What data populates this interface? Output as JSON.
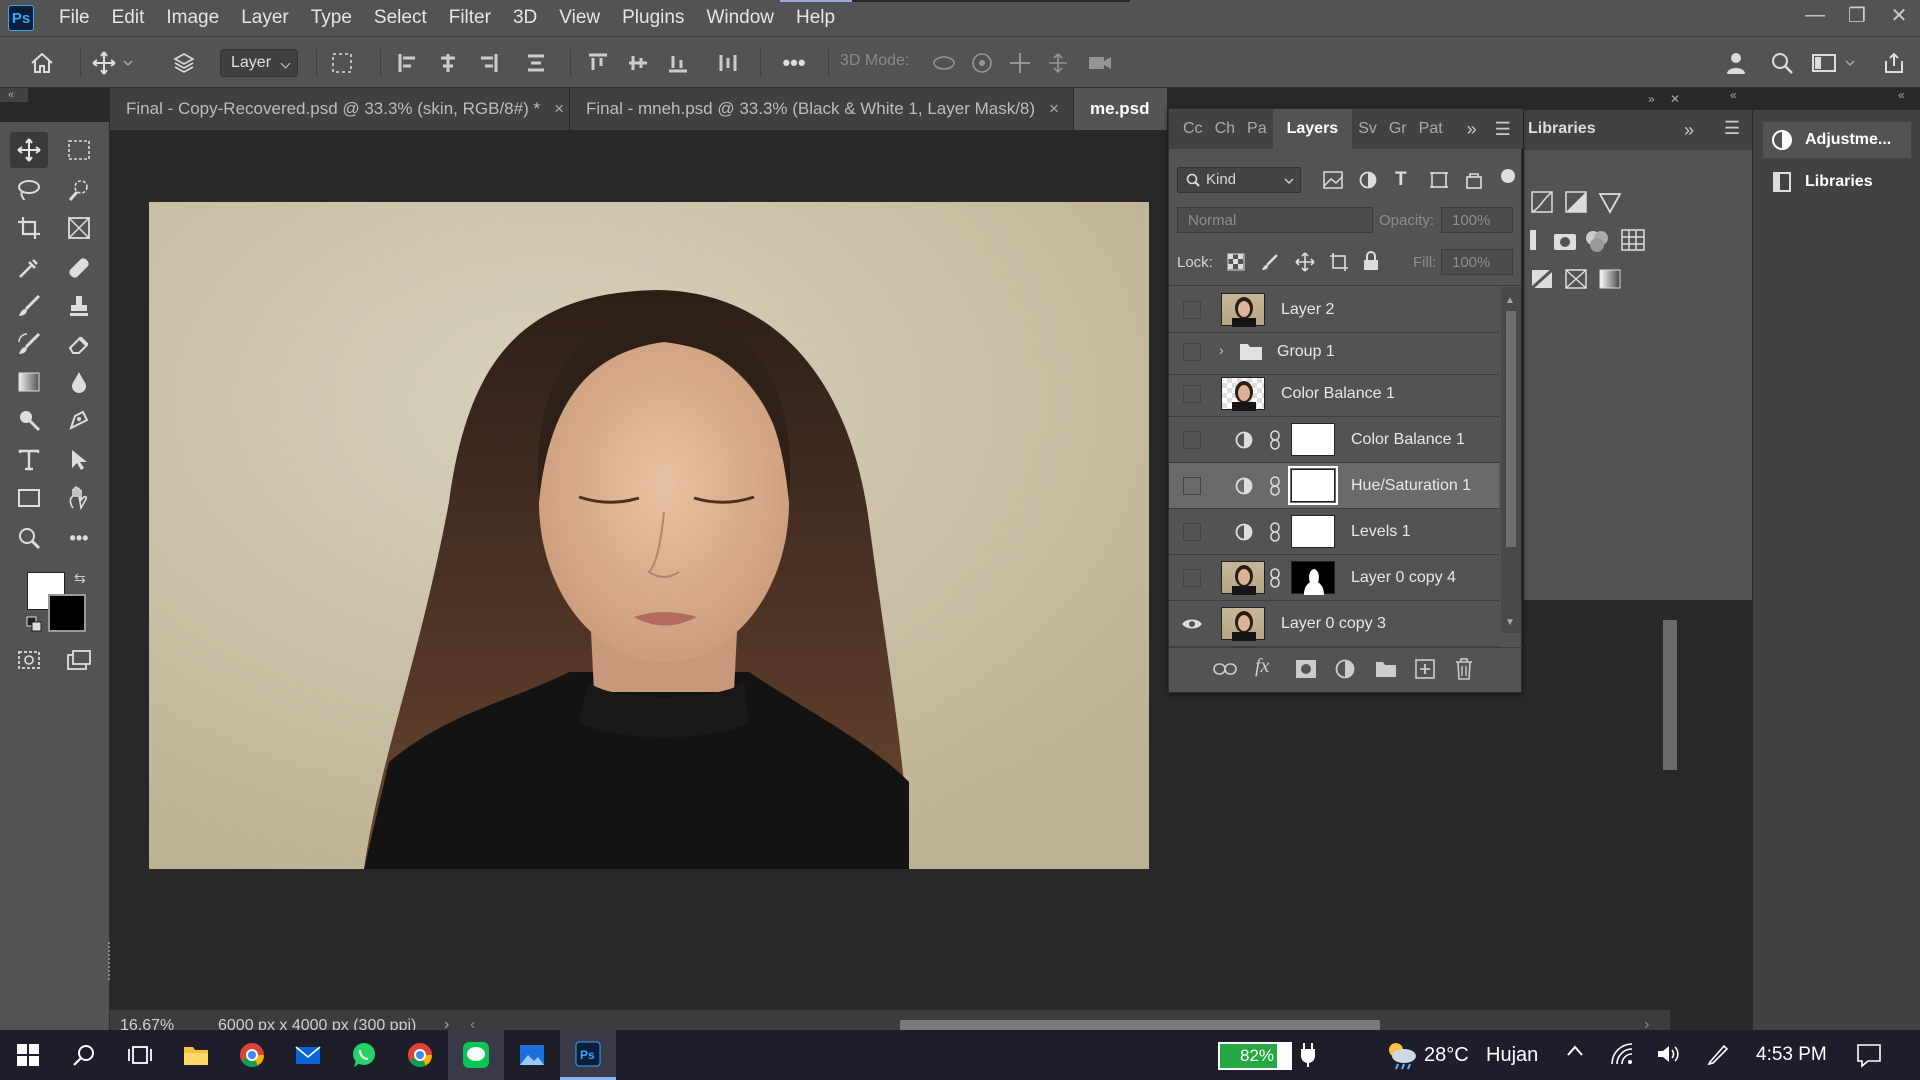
{
  "app": {
    "logo": "Ps"
  },
  "menu": [
    "File",
    "Edit",
    "Image",
    "Layer",
    "Type",
    "Select",
    "Filter",
    "3D",
    "View",
    "Plugins",
    "Window",
    "Help"
  ],
  "options": {
    "layer_select": "Layer",
    "mode_3d_label": "3D Mode:"
  },
  "doc_tabs": [
    {
      "label": "Final - Copy-Recovered.psd @ 33.3% (skin, RGB/8#) *",
      "close": "×"
    },
    {
      "label": "Final - mneh.psd @ 33.3% (Black & White 1, Layer Mask/8)",
      "close": "×"
    },
    {
      "label": "me.psd"
    }
  ],
  "status": {
    "zoom": "16.67%",
    "doc_info": "6000 px x 4000 px (300 ppi)"
  },
  "layers_panel": {
    "tabs": [
      "Cc",
      "Ch",
      "Pa",
      "Layers",
      "Sv",
      "Gr",
      "Pat"
    ],
    "kind": "Kind",
    "blend": "Normal",
    "opacity_label": "Opacity:",
    "opacity": "100%",
    "lock_label": "Lock:",
    "fill_label": "Fill:",
    "fill": "100%",
    "rows": [
      {
        "name": "Layer 2"
      },
      {
        "name": "Group 1"
      },
      {
        "name": "Color Balance 1"
      },
      {
        "name": "Color Balance 1"
      },
      {
        "name": "Hue/Saturation 1"
      },
      {
        "name": "Levels 1"
      },
      {
        "name": "Layer 0 copy 4"
      },
      {
        "name": "Layer 0 copy 3"
      }
    ]
  },
  "mid_panel": {
    "title": "Libraries"
  },
  "far_right": {
    "adjust": "Adjustme...",
    "libraries": "Libraries"
  },
  "taskbar": {
    "battery": "82%",
    "temp": "28°C",
    "weather": "Hujan",
    "time": "4:53 PM"
  },
  "colors": {
    "accent": "#31a8ff",
    "panel": "#535353",
    "dark": "#282828"
  }
}
